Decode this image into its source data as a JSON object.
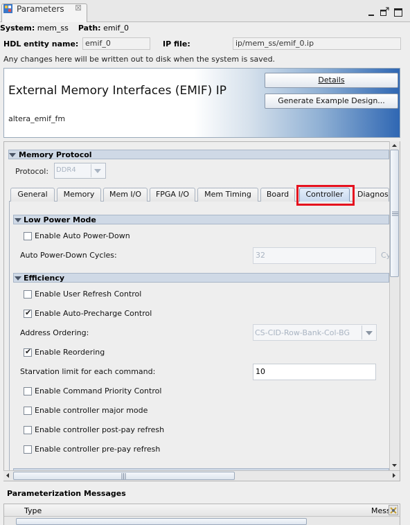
{
  "window": {
    "tab_title": "Parameters",
    "tab_close_glyph": "⊠",
    "icons": [
      "parameters-icon",
      "close-icon",
      "minimize-icon",
      "maximize-icon",
      "restore-icon"
    ]
  },
  "system_line": {
    "system_label": "System:",
    "system_value": "mem_ss",
    "path_label": "Path:",
    "path_value": "emif_0"
  },
  "hdl": {
    "entity_label": "HDL entity name:",
    "entity_value": "emif_0",
    "ipfile_label": "IP file:",
    "ipfile_value": "ip/mem_ss/emif_0.ip"
  },
  "notice": "Any changes here will be written out to disk when the system is saved.",
  "header": {
    "title": "External Memory Interfaces (EMIF) IP",
    "subtitle": "altera_emif_fm",
    "details_button": "Details",
    "generate_button": "Generate Example Design..."
  },
  "memory_protocol": {
    "section_label": "Memory Protocol",
    "protocol_label": "Protocol:",
    "protocol_value": "DDR4"
  },
  "tabs": [
    {
      "label": "General"
    },
    {
      "label": "Memory"
    },
    {
      "label": "Mem I/O"
    },
    {
      "label": "FPGA I/O"
    },
    {
      "label": "Mem Timing"
    },
    {
      "label": "Board"
    },
    {
      "label": "Controller"
    },
    {
      "label": "Diagnostics"
    }
  ],
  "selected_tab": "Controller",
  "low_power": {
    "section_label": "Low Power Mode",
    "auto_power_down_label": "Enable Auto Power-Down",
    "auto_power_down_checked": false,
    "cycles_label": "Auto Power-Down Cycles:",
    "cycles_value": "32",
    "cycles_unit": "Cy"
  },
  "efficiency": {
    "section_label": "Efficiency",
    "user_refresh_label": "Enable User Refresh Control",
    "user_refresh_checked": false,
    "auto_precharge_label": "Enable Auto-Precharge Control",
    "auto_precharge_checked": true,
    "address_ordering_label": "Address Ordering:",
    "address_ordering_value": "CS-CID-Row-Bank-Col-BG",
    "reordering_label": "Enable Reordering",
    "reordering_checked": true,
    "starvation_label": "Starvation limit for each command:",
    "starvation_value": "10",
    "cmd_priority_label": "Enable Command Priority Control",
    "cmd_priority_checked": false,
    "major_mode_label": "Enable controller major mode",
    "major_mode_checked": false,
    "post_pay_label": "Enable controller post-pay refresh",
    "post_pay_checked": false,
    "pre_pay_label": "Enable controller pre-pay refresh",
    "pre_pay_checked": false
  },
  "messages": {
    "section_label": "Parameterization Messages",
    "col_type": "Type",
    "col_message": "Mess"
  }
}
